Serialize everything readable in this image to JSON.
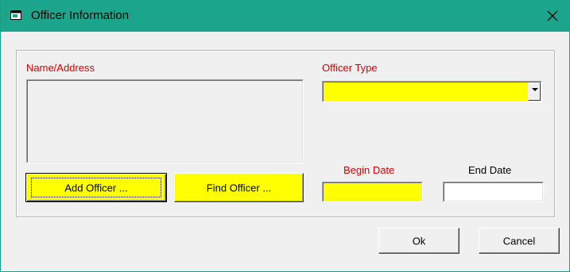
{
  "window": {
    "title": "Officer Information"
  },
  "icons": {
    "title_icon": "window-icon",
    "close": "close-icon",
    "dropdown": "chevron-down-icon"
  },
  "form": {
    "name_address_label": "Name/Address",
    "name_address_value": "",
    "officer_type_label": "Officer Type",
    "officer_type_value": "",
    "begin_date_label": "Begin Date",
    "begin_date_value": "",
    "end_date_label": "End Date",
    "end_date_value": "",
    "add_officer_label": "Add Officer ...",
    "find_officer_label": "Find Officer ..."
  },
  "footer": {
    "ok_label": "Ok",
    "cancel_label": "Cancel"
  },
  "colors": {
    "titlebar": "#1ba58c",
    "required_field": "#ffff00",
    "required_label": "#e00000"
  }
}
